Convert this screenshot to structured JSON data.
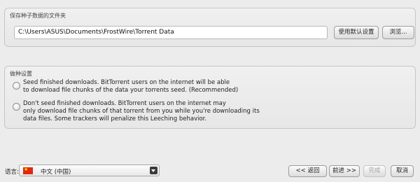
{
  "folder_section": {
    "title": "保存种子数据的文件夹",
    "path_value": "C:\\Users\\ASUS\\Documents\\FrostWire\\Torrent Data",
    "default_button": "使用默认设置",
    "browse_button": "浏览..."
  },
  "seed_section": {
    "title": "做种设置",
    "options": [
      {
        "lines": [
          "Seed finished downloads. BitTorrent users on the internet will be able",
          "to download file chunks of the data your torrents seed. (Recommended)"
        ],
        "selected": false
      },
      {
        "lines": [
          "Don't seed finished downloads. BitTorrent users on the internet may",
          "only download file chunks of that torrent from you while you're downloading its",
          "data files. Some trackers will penalize this Leeching behavior."
        ],
        "selected": false
      }
    ]
  },
  "footer": {
    "language_label": "语言:",
    "language_value": "中文 (中国)",
    "flag_icon": "china-flag-icon",
    "back_button": "<< 返回",
    "next_button": "前进 >>",
    "finish_button": "完成",
    "cancel_button": "取消"
  }
}
